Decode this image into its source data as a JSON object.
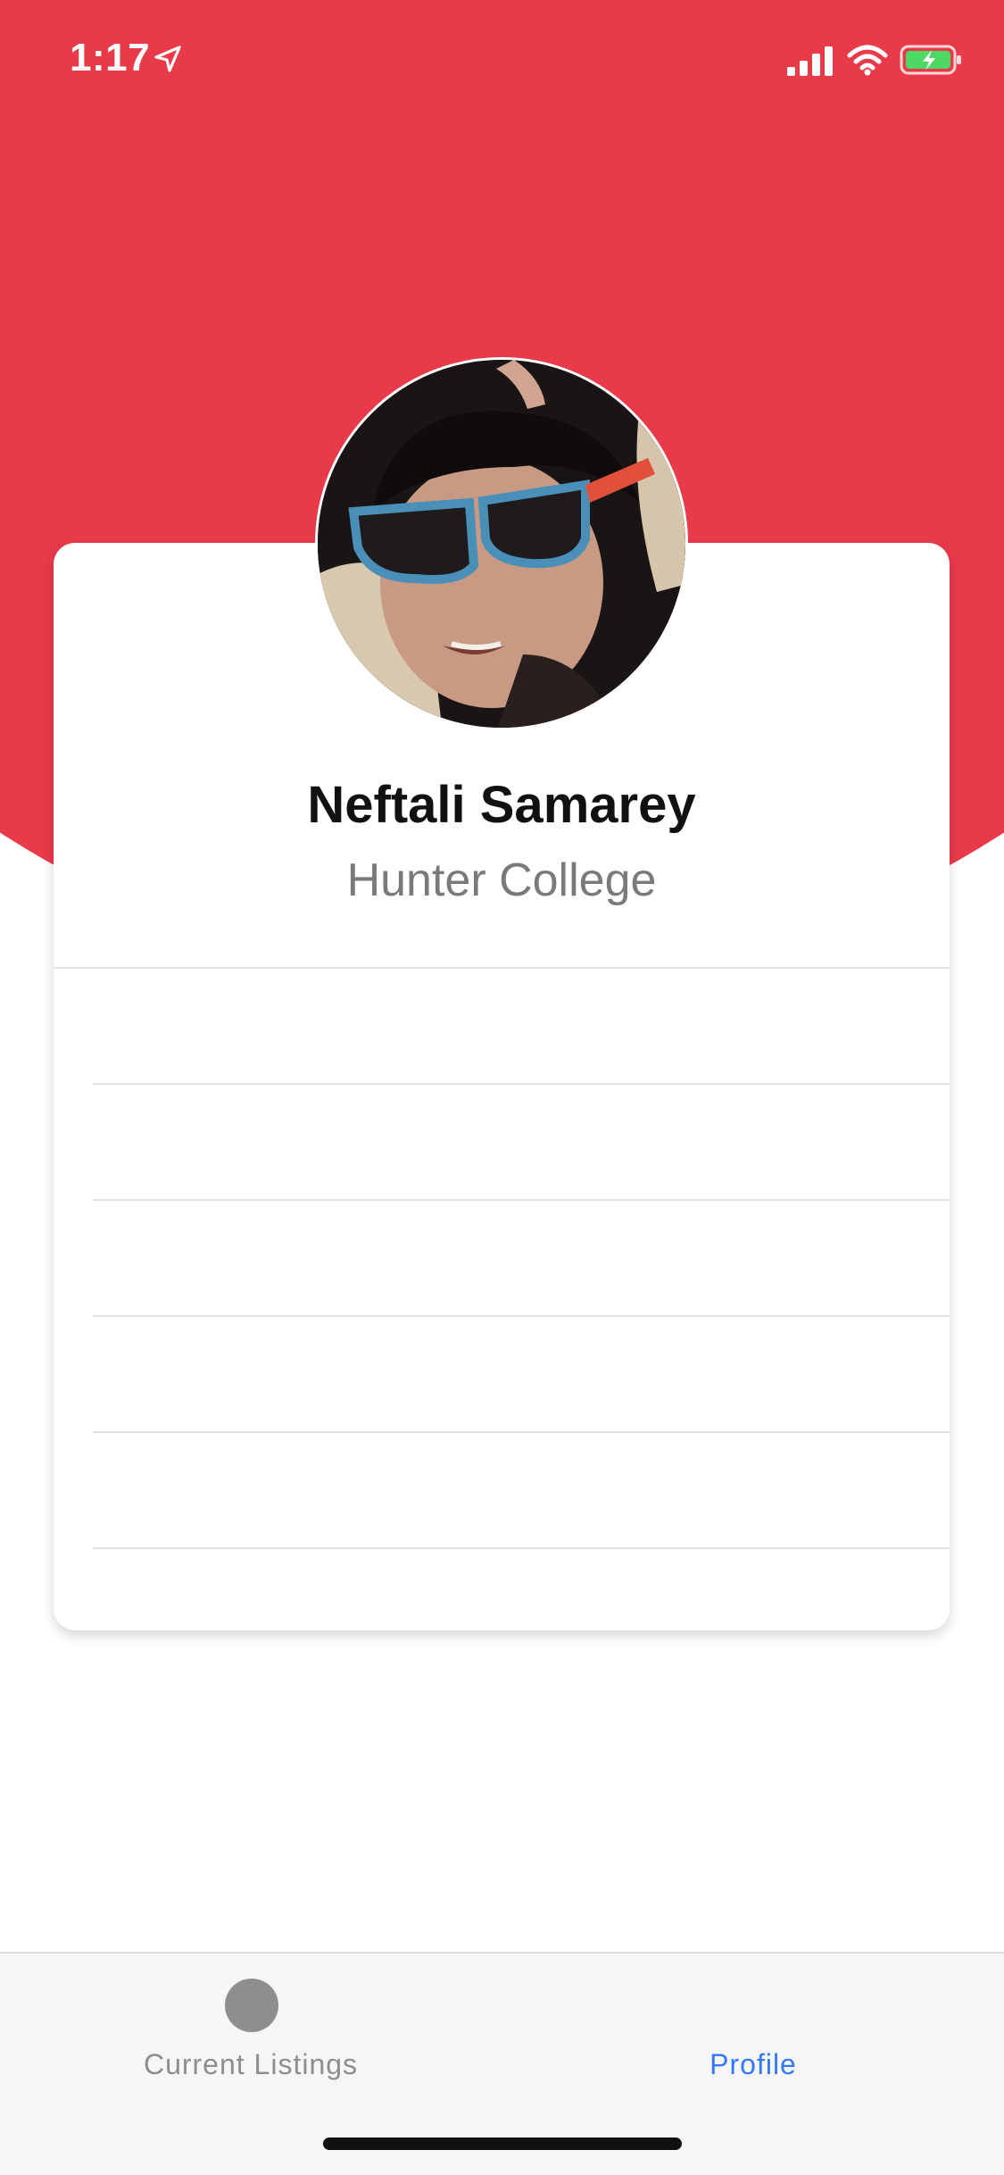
{
  "status_bar": {
    "time": "1:17"
  },
  "profile": {
    "name": "Neftali Samarey",
    "school": "Hunter College"
  },
  "tabs": [
    {
      "label": "Current Listings",
      "active": false
    },
    {
      "label": "Profile",
      "active": true
    }
  ],
  "colors": {
    "header_red": "#e93a4a",
    "active_tab": "#3478f6",
    "inactive_tab": "#8e8e8e"
  },
  "icons": {
    "status": [
      "location-arrow-icon",
      "cellular-signal-icon",
      "wifi-icon",
      "battery-charging-icon"
    ],
    "tab_listings": "circle-placeholder-icon"
  }
}
